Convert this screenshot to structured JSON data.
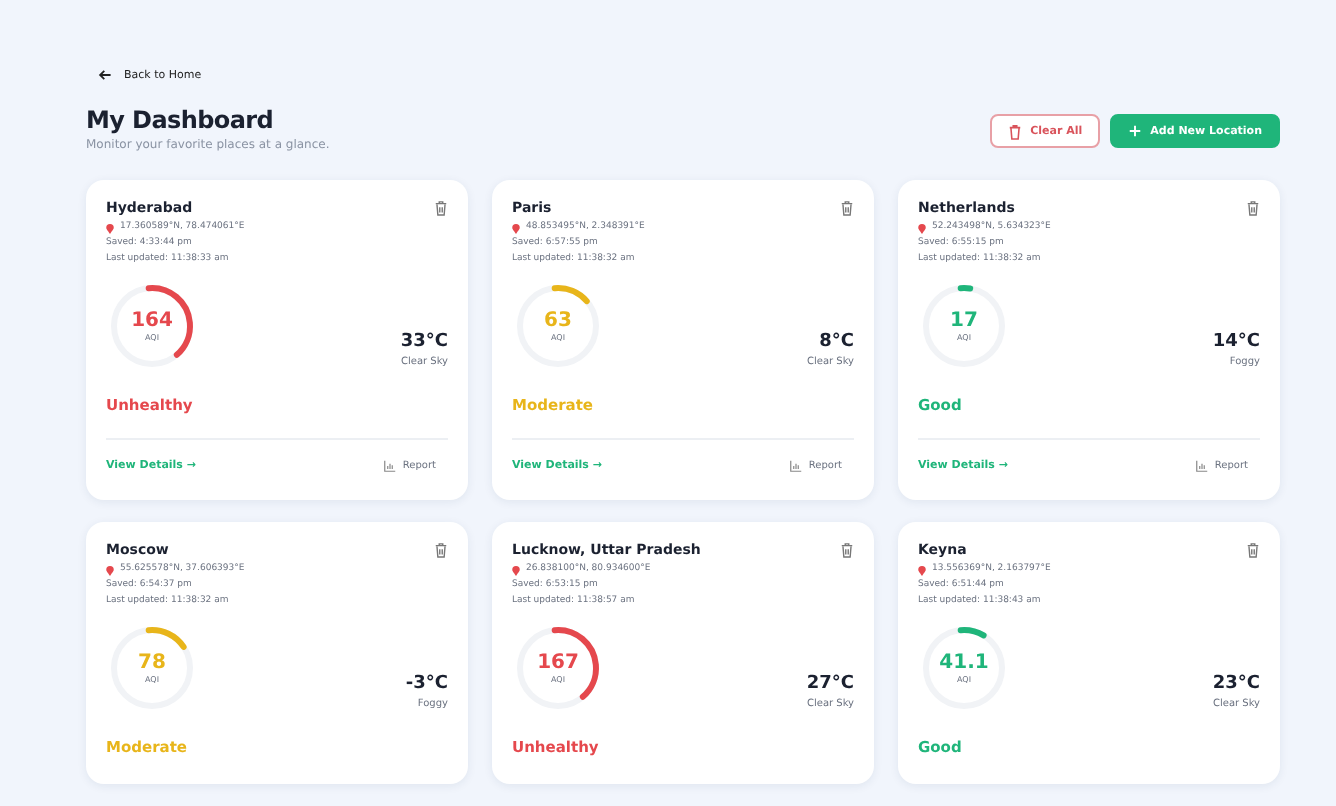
{
  "back_link": {
    "label": "Back to Home"
  },
  "header": {
    "title": "My Dashboard",
    "subtitle": "Monitor your favorite places at a glance.",
    "buttons": [
      {
        "kind": "outline",
        "label": "Clear All"
      },
      {
        "kind": "primary",
        "label": "Add New Location"
      }
    ]
  },
  "cards": [
    {
      "name": "Hyderabad",
      "coords": "17.360589°N, 78.474061°E",
      "saved": "Saved: 4:33:44 pm",
      "updated": "Last updated: 11:38:33 am",
      "aqi": "164",
      "aqi_label": "AQI",
      "level": 0.4,
      "color": "#e5484d",
      "temperature": "33°C",
      "condition": "Clear Sky",
      "status": "Unhealthy",
      "details": "View Details →",
      "report": "Report"
    },
    {
      "name": "Paris",
      "coords": "48.853495°N, 2.348391°E",
      "saved": "Saved: 6:57:55 pm",
      "updated": "Last updated: 11:38:32 am",
      "aqi": "63",
      "aqi_label": "AQI",
      "level": 0.15,
      "color": "#e8b51a",
      "temperature": "8°C",
      "condition": "Clear Sky",
      "status": "Moderate",
      "details": "View Details →",
      "report": "Report"
    },
    {
      "name": "Netherlands",
      "coords": "52.243498°N, 5.634323°E",
      "saved": "Saved: 6:55:15 pm",
      "updated": "Last updated: 11:38:32 am",
      "aqi": "17",
      "aqi_label": "AQI",
      "level": 0.04,
      "color": "#1fb57a",
      "temperature": "14°C",
      "condition": "Foggy",
      "status": "Good",
      "details": "View Details →",
      "report": "Report"
    },
    {
      "name": "Moscow",
      "coords": "55.625578°N, 37.606393°E",
      "saved": "Saved: 6:54:37 pm",
      "updated": "Last updated: 11:38:32 am",
      "aqi": "78",
      "aqi_label": "AQI",
      "level": 0.17,
      "color": "#e8b51a",
      "temperature": "-3°C",
      "condition": "Foggy",
      "status": "Moderate"
    },
    {
      "name": "Lucknow, Uttar Pradesh",
      "coords": "26.838100°N, 80.934600°E",
      "saved": "Saved: 6:53:15 pm",
      "updated": "Last updated: 11:38:57 am",
      "aqi": "167",
      "aqi_label": "AQI",
      "level": 0.4,
      "color": "#e5484d",
      "temperature": "27°C",
      "condition": "Clear Sky",
      "status": "Unhealthy"
    },
    {
      "name": "Keyna",
      "coords": "13.556369°N, 2.163797°E",
      "saved": "Saved: 6:51:44 pm",
      "updated": "Last updated: 11:38:43 am",
      "aqi": "41.1",
      "aqi_label": "AQI",
      "level": 0.1,
      "color": "#1fb57a",
      "temperature": "23°C",
      "condition": "Clear Sky",
      "status": "Good"
    }
  ]
}
